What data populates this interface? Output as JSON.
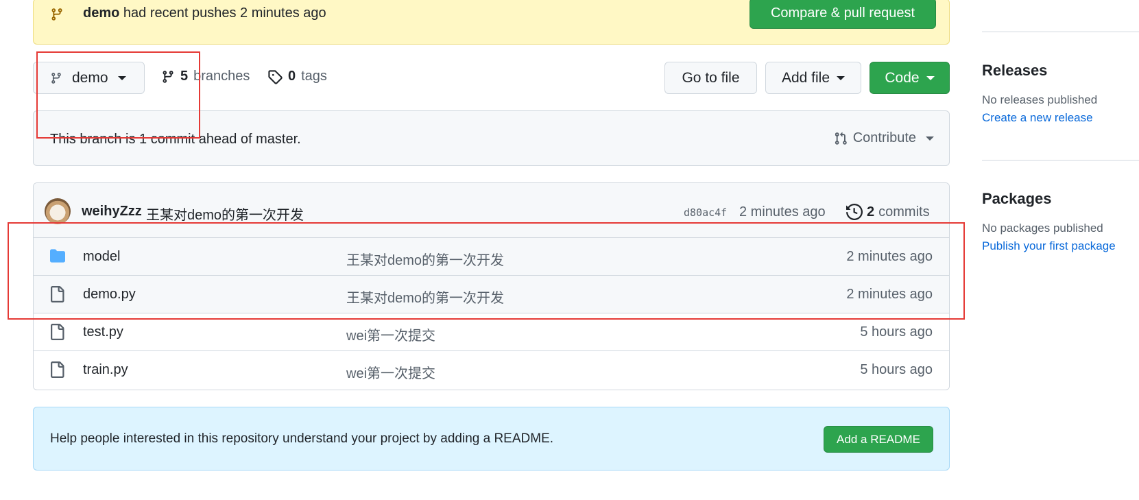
{
  "banner": {
    "branch": "demo",
    "text": "had recent pushes 2 minutes ago",
    "compare_button": "Compare & pull request"
  },
  "toolbar": {
    "branch_name": "demo",
    "branches_count": "5",
    "branches_label": "branches",
    "tags_count": "0",
    "tags_label": "tags",
    "go_to_file": "Go to file",
    "add_file": "Add file",
    "code": "Code"
  },
  "ahead": {
    "text": "This branch is 1 commit ahead of master.",
    "contribute": "Contribute"
  },
  "latest_commit": {
    "author": "weihyZzz",
    "message": "王某对demo的第一次开发",
    "sha": "d80ac4f",
    "time": "2 minutes ago",
    "commits_count": "2",
    "commits_label": "commits"
  },
  "files": [
    {
      "type": "folder",
      "name": "model",
      "message": "王某对demo的第一次开发",
      "age": "2 minutes ago"
    },
    {
      "type": "file",
      "name": "demo.py",
      "message": "王某对demo的第一次开发",
      "age": "2 minutes ago"
    },
    {
      "type": "file",
      "name": "test.py",
      "message": "wei第一次提交",
      "age": "5 hours ago"
    },
    {
      "type": "file",
      "name": "train.py",
      "message": "wei第一次提交",
      "age": "5 hours ago"
    }
  ],
  "readme": {
    "text": "Help people interested in this repository understand your project by adding a README.",
    "button": "Add a README"
  },
  "sidebar": {
    "releases": {
      "title": "Releases",
      "empty": "No releases published",
      "link": "Create a new release"
    },
    "packages": {
      "title": "Packages",
      "empty": "No packages published",
      "link": "Publish your first package"
    }
  },
  "colors": {
    "accent_green": "#2da44e",
    "link_blue": "#0969da",
    "annotation_red": "#e53935",
    "banner_yellow": "#fff8c5",
    "readme_blue": "#ddf4ff"
  }
}
